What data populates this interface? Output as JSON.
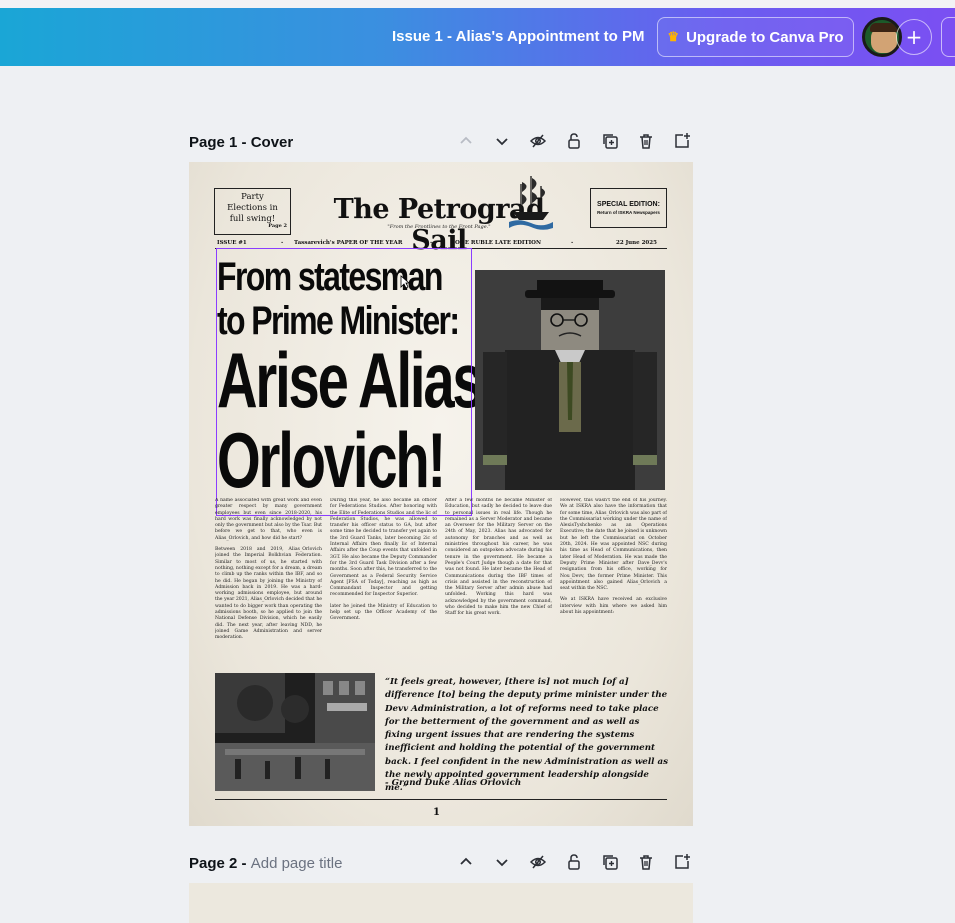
{
  "topbar": {
    "doc_title": "Issue 1 - Alias's Appointment to PM",
    "upgrade_label": "Upgrade to Canva Pro",
    "add_label": "+"
  },
  "pages": [
    {
      "number": "Page 1",
      "separator": " - ",
      "title": "Cover"
    },
    {
      "number": "Page 2",
      "separator": " - ",
      "title": "Add page title"
    }
  ],
  "paper": {
    "side_box_left": [
      "Party",
      "Elections in",
      "full swing!"
    ],
    "side_box_left_page": "Page 2",
    "masthead": "The Petrograd Sail",
    "tagline": "\"From the Frontlines to the Front Page.\"",
    "side_box_right_title": "SPECIAL EDITION:",
    "side_box_right_sub": "Return of ISKRA Newspapers",
    "info": {
      "issue": "ISSUE #1",
      "sep1": "-",
      "paper_of_year": "Tassarevich's PAPER OF THE YEAR",
      "sep2": "-",
      "edition": "ONE RUBLE LATE EDITION",
      "sep3": "-",
      "date": "22 June 2025"
    },
    "headline_small_1": "From statesman",
    "headline_small_2": "to Prime Minister:",
    "headline_big_1": "Arise Alias",
    "headline_big_2": "Orlovich!",
    "columns": [
      [
        "A name associated with great work and even greater respect by many government employees but even since 2018-2020, his hard work was finally acknowledged by not only the government but also by the Tsar. But before we get to that, who even is Alias_Orlovich, and how did he start?",
        "Between 2018 and 2019, Alias_Orlovich joined the Imperial Bolkhvian Federation. Similar to most of us, he started with nothing, nothing except for a dream, a dream to climb up the ranks within the IBF, and so he did. He began by joining the Ministry of Admission back in 2019. He was a hard-working admissions employee, but around the year 2021, Alias_Orlovich decided that he wanted to do bigger work than operating the admissions booth, so he applied to join the National Defense Division, which he easily did. The next year, after leaving NDD, he joined Game Administration and server moderation."
      ],
      [
        "During this year, he also became an officer for Federations Studios. After honoring with the Elite of Federations Studios and the lic of Federation Studios, he was allowed to transfer his officer status to GA, but after some time he decided to transfer yet again to the 3rd Guard Tanks, later becoming 2ic of Internal Affairs then finally lic of Internal Affairs after the Coup events that unfolded in 3GT. He also became the Deputy Commander for the 3rd Guard Task Division after a few months. Soon after this, he transferred to the Government as a Federal Security Service Agent [FSA of Today], reaching as high as Commandant Inspector and getting recommended for Inspector Superior.",
        "later he joined the Ministry of Education to help set up the Officer Academy of the Government."
      ],
      [
        "After a few months he became Minister of Education, but sadly he decided to leave due to personal issues in real life. Though he remained as a Server Moderator and became an Overseer for the Military Server on the 24th of May, 2023. Alias has advocated for autonomy for branches and as well as ministries throughout his career, he was considered an outspoken advocate during his tenure in the government. He became a People's Court Judge though a date for that was not found. He later became the Head of Communications during the IBF times of crisis and assisted in the reconstruction of the Military Server after admin abuse had unfolded. Working this hard was acknowledged by the government command, who decided to make him the new Chief of Staff for his great work."
      ],
      [
        "However, this wasn't the end of his journey. We at ISKRA also have the information that for some time, Alias_Orlovich was also part of the Commissariat working under the name of AlexisTyshchenko as an Operations Executive; the date that he joined is unknown but he left the Commissariat on October 20th, 2024. He was appointed NSC during his time as Head of Communications, then later Head of Moderation. He was made the Deputy Prime Minister after Dave_Devv's resignation from his office, working for Nou_Devv, the former Prime Minister. This appointment also gained Alias_Orlovich a seat within the NSC.",
        "We at ISKRA have received an exclusive interview with him where we asked him about his appointment:"
      ]
    ],
    "quote": "“It feels great, however, [there is] not much [of a] difference [to] being the deputy prime minister under the Devv Administration, a lot of reforms need to take place for the betterment of the government and as well as fixing urgent issues that are rendering the systems inefficient and holding the potential of the government back. I feel confident in the new Administration as well as the newly appointed government leadership alongside me.”",
    "quote_by": "- Grand Duke Alias Orlovich",
    "page_number": "1"
  },
  "colors": {
    "accent_selection": "#8b3dff",
    "crown": "#ffb400"
  }
}
